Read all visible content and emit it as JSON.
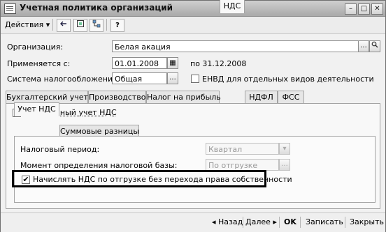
{
  "window": {
    "title": "Учетная политика организаций"
  },
  "toolbar": {
    "actions_label": "Действия",
    "dropdown_arrow": "▾",
    "help_label": "?"
  },
  "form": {
    "org_label": "Организация:",
    "org_value": "Белая акация",
    "applies_label": "Применяется с:",
    "applies_value": "01.01.2008",
    "applies_to": "по 31.12.2008",
    "tax_label": "Система налогообложения:",
    "tax_value": "Общая",
    "envd_label": "ЕНВД для отдельных видов деятельности",
    "envd_checked": false
  },
  "tabs": [
    {
      "label": "Бухгалтерский учет",
      "active": false
    },
    {
      "label": "Производство",
      "active": false
    },
    {
      "label": "Налог на прибыль",
      "active": false
    },
    {
      "label": "НДС",
      "active": true
    },
    {
      "label": "НДФЛ",
      "active": false
    },
    {
      "label": "ФСС",
      "active": false
    }
  ],
  "nds": {
    "simplified_label": "Упрощенный учет НДС",
    "simplified_checked": true,
    "subtabs": [
      {
        "label": "Учет НДС",
        "active": true
      },
      {
        "label": "Суммовые разницы",
        "active": false
      }
    ],
    "period_label": "Налоговый период:",
    "period_value": "Квартал",
    "base_label": "Момент определения налоговой базы:",
    "base_value": "По отгрузке",
    "accrue_label": "Начислять НДС по отгрузке без перехода права собственности",
    "accrue_checked": true
  },
  "bottom": {
    "back_label": "◂ Назад",
    "next_label": "Далее ▸",
    "ok_label": "OK",
    "save_label": "Записать",
    "close_label": "Закрыть"
  },
  "glyphs": {
    "check": "✔",
    "ellipsis": "...",
    "calendar": "▦",
    "dropdown": "▾",
    "x": "✕",
    "min": "–",
    "max": "□"
  }
}
